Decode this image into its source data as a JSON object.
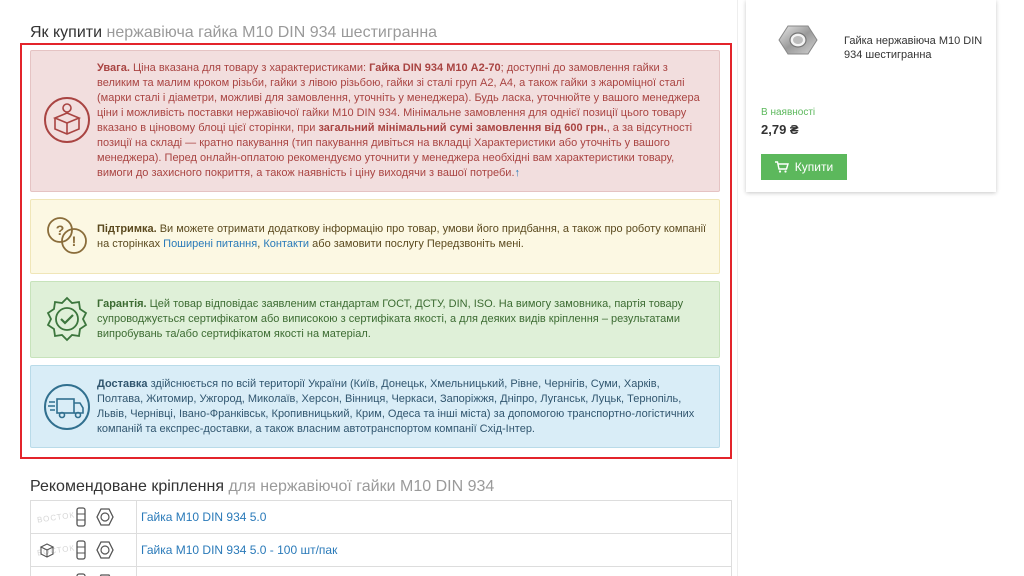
{
  "howto": {
    "title": "Як купити",
    "title_muted": "нержавіюча гайка М10 DIN 934 шестигранна"
  },
  "warning": {
    "label": "Увага.",
    "t1": "Ціна вказана для товару з характеристиками:",
    "spec": "Гайка DIN 934 М10 A2-70",
    "t2": "; доступні до замовлення гайки з великим та малим кроком різьби, гайки з лівою різьбою, гайки зі сталі груп А2, А4, а також гайки з жароміцної сталі (марки сталі і діаметри, можливі для замовлення, уточніть у менеджера). Будь ласка, уточнюйте у вашого менеджера ціни і можливість поставки нержавіючої гайки М10 DIN 934. Мінімальне замовлення для однієї позиції цього товару вказано в ціновому блоці цієї сторінки, при",
    "min_order": "загальний мінімальний сумі замовлення від 600 грн.",
    "t3": ", а за відсутності позиції на складі — кратно пакування (тип пакування дивіться на вкладці Характеристики або уточніть у вашого менеджера). Перед онлайн-оплатою рекомендуємо уточнити у менеджера необхідні вам характеристики товару, вимоги до захисного покриття, а також наявність і ціну виходячи з вашої потреби.",
    "arrow": "↑"
  },
  "support": {
    "label": "Підтримка.",
    "t1": "Ви можете отримати додаткову інформацію про товар, умови його придбання, а також про роботу компанії на сторінках",
    "link1": "Поширені питання",
    "sep": ",",
    "link2": "Контакти",
    "t2": "або замовити послугу Передзвоніть мені."
  },
  "guarantee": {
    "label": "Гарантія.",
    "text": "Цей товар відповідає заявленим стандартам ГОСТ, ДСТУ, DIN, ISO. На вимогу замовника, партія товару супроводжується сертифікатом або виписокою з сертифіката якості, а для деяких видів кріплення – результатами випробувань та/або сертифікатом якості на матеріал."
  },
  "delivery": {
    "label": "Доставка",
    "text": "здійснюється по всій території України (Київ, Донецьк, Хмельницький, Рівне, Чернігів, Суми, Харків, Полтава, Житомир, Ужгород, Миколаїв, Херсон, Вінниця, Черкаси, Запоріжжя, Дніпро, Луганськ, Луцьк, Тернопіль, Львів, Чернівці, Івано-Франківськ, Кропивницький, Крим, Одеса та інші міста) за допомогою транспортно-логістичних компаній та експрес-доставки, а також власним автотранспортом компанії Схід-Інтер."
  },
  "recommended": {
    "title": "Рекомендоване кріплення",
    "title_muted": "для нержавіючої гайки М10 DIN 934",
    "rows": [
      {
        "name": "Гайка М10 DIN 934 5.0",
        "watermark": "ВОСТОК"
      },
      {
        "name": "Гайка М10 DIN 934 5.0 - 100 шт/пак",
        "watermark": "ВОСТОК"
      }
    ]
  },
  "product": {
    "name": "Гайка нержавіюча М10 DIN 934 шестигранна",
    "stock": "В наявності",
    "price": "2,79 ₴",
    "buy_label": "Купити"
  },
  "colors": {
    "frame": "#e3242b",
    "warning": "#a94442",
    "support": "#8a6d3b",
    "guarantee": "#3c763d",
    "delivery": "#31708f",
    "buy": "#5cb85c",
    "link": "#2a7ab9"
  },
  "icons": {
    "warning": "box-warning-icon",
    "support": "question-exclamation-icon",
    "guarantee": "certificate-check-icon",
    "delivery": "delivery-truck-icon",
    "cart": "cart-icon"
  }
}
